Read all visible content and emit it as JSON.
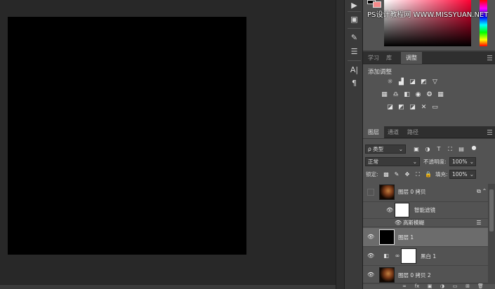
{
  "watermark": "PS设计教程网 WWW.MISSYUAN.NET",
  "color_panel": {
    "foreground": "#000000",
    "background": "#f48a8a"
  },
  "top_tabs": [
    {
      "label": "学习",
      "active": false
    },
    {
      "label": "库",
      "active": false
    },
    {
      "label": "调整",
      "active": true
    }
  ],
  "adjustments": {
    "title": "添加调整",
    "row1_icons": [
      "brightness-contrast-icon",
      "levels-icon",
      "curves-icon",
      "exposure-icon",
      "vibrance-icon"
    ],
    "row2_icons": [
      "hue-saturation-icon",
      "color-balance-icon",
      "black-white-icon",
      "photo-filter-icon",
      "channel-mixer-icon",
      "color-lookup-icon"
    ],
    "row3_icons": [
      "invert-icon",
      "posterize-icon",
      "threshold-icon",
      "selective-color-icon",
      "gradient-map-icon"
    ]
  },
  "layer_tabs": [
    {
      "label": "图层",
      "active": true
    },
    {
      "label": "通道",
      "active": false
    },
    {
      "label": "路径",
      "active": false
    }
  ],
  "layers_panel": {
    "filter_kind": "类型",
    "filter_search_glyph": "ρ",
    "blend_mode": "正常",
    "opacity_label": "不透明度:",
    "opacity_value": "100%",
    "lock_label": "锁定:",
    "fill_label": "填充:",
    "fill_value": "100%"
  },
  "layers": [
    {
      "name": "图层 0 拷贝",
      "visible": false,
      "thumb": "portrait",
      "selected": false
    },
    {
      "name": "智能滤镜",
      "visible": true,
      "thumb": "white",
      "selected": false
    },
    {
      "name": "高斯模糊",
      "visible": true,
      "thumb": "",
      "selected": false
    },
    {
      "name": "图层 1",
      "visible": true,
      "thumb": "black",
      "selected": true
    },
    {
      "name": "黑白 1",
      "visible": true,
      "thumb": "white",
      "selected": false
    },
    {
      "name": "图层 0 拷贝 2",
      "visible": true,
      "thumb": "portrait",
      "selected": false
    }
  ]
}
